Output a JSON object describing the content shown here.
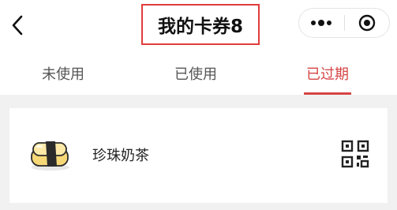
{
  "header": {
    "title": "我的卡券8",
    "back_icon": "chevron-left-icon",
    "more_icon": "more-dots-icon",
    "close_icon": "target-circle-icon"
  },
  "tabs": [
    {
      "label": "未使用",
      "active": false
    },
    {
      "label": "已使用",
      "active": false
    },
    {
      "label": "已过期",
      "active": true
    }
  ],
  "coupons": [
    {
      "name": "珍珠奶茶",
      "image_icon": "sushi-icon",
      "action_icon": "qr-code-icon"
    }
  ],
  "colors": {
    "accent": "#d64545",
    "title_outline": "#e23b3b",
    "background": "#f1f1f1"
  }
}
